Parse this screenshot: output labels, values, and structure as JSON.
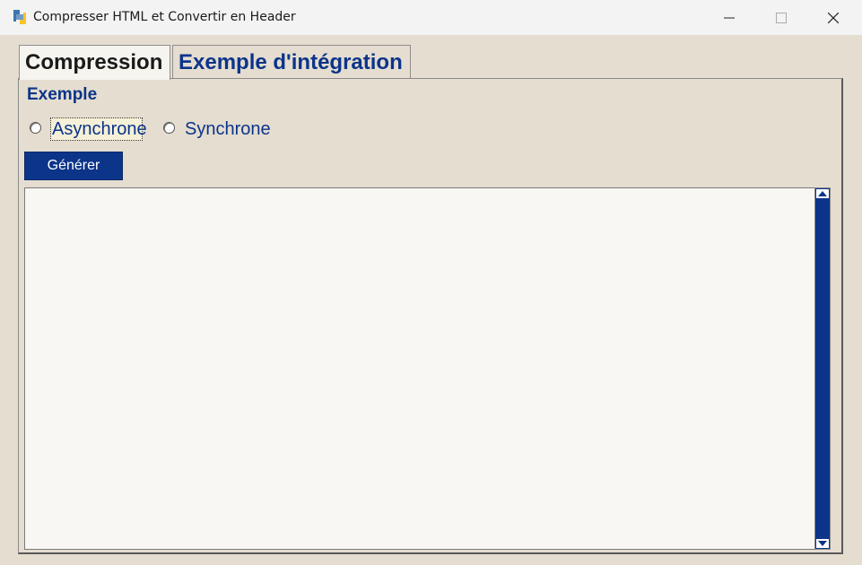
{
  "window": {
    "title": "Compresser HTML et Convertir en Header"
  },
  "tabs": [
    {
      "label": "Compression",
      "active": true
    },
    {
      "label": "Exemple d'intégration",
      "active": false
    }
  ],
  "section": {
    "label": "Exemple"
  },
  "radios": [
    {
      "label": "Asynchrone",
      "selected": false,
      "focused": true
    },
    {
      "label": "Synchrone",
      "selected": false,
      "focused": false
    }
  ],
  "buttons": {
    "generate_label": "Générer"
  },
  "output": {
    "value": ""
  },
  "colors": {
    "accent": "#0c3489",
    "background": "#e4ddd0",
    "titlebar": "#f3f3f3"
  },
  "icons": [
    "python-app-icon",
    "minimize-icon",
    "maximize-icon",
    "close-icon",
    "scroll-up-icon",
    "scroll-down-icon"
  ]
}
